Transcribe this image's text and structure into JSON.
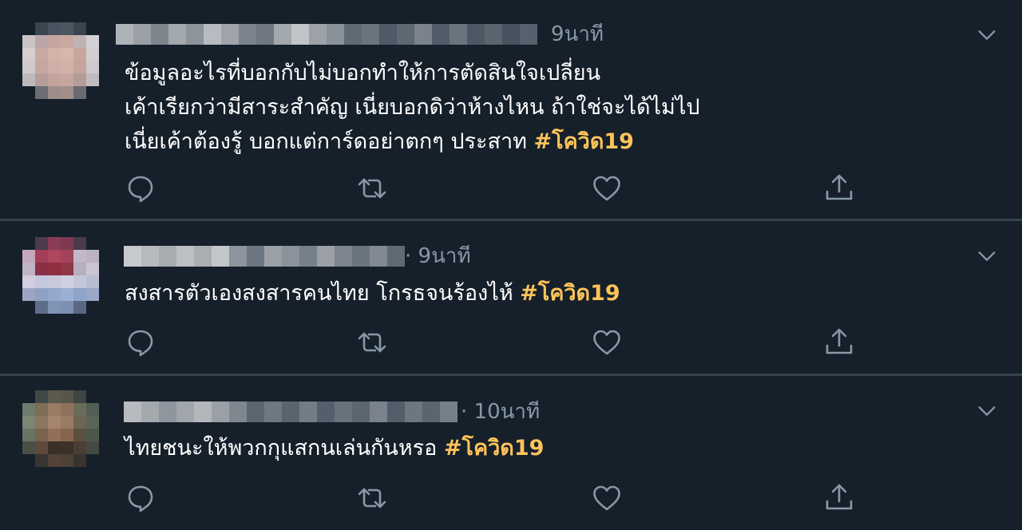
{
  "tweets": [
    {
      "time": "9นาที",
      "lines": [
        "ข้อมูลอะไรที่บอกกับไม่บอกทำให้การตัดสินใจเปลี่ยน",
        "เค้าเรียกว่ามีสาระสำคัญ เนี่ยบอกดิว่าห้างไหน ถ้าใช่จะได้ไม่ไป",
        "เนี่ยเค้าต้องรู้ บอกแต่การ์ดอย่าตกๆ ประสาท"
      ],
      "hashtag": "#โควิด19"
    },
    {
      "time": "· 9นาที",
      "lines": [
        "สงสารตัวเองสงสารคนไทย โกรธจนร้องไห้ "
      ],
      "hashtag": "#โควิด19"
    },
    {
      "time": "· 10นาที",
      "lines": [
        "ไทยชนะให้พวกกุแสกนเล่นกันหรอ "
      ],
      "hashtag": "#โควิด19"
    }
  ],
  "icons": {
    "reply": "reply-icon",
    "retweet": "retweet-icon",
    "like": "heart-icon",
    "share": "share-icon",
    "menu": "chevron-down-icon"
  },
  "colors": {
    "background": "#15202b",
    "divider": "#38444d",
    "secondary_text": "#8899a6",
    "hashtag": "#ffc459"
  }
}
